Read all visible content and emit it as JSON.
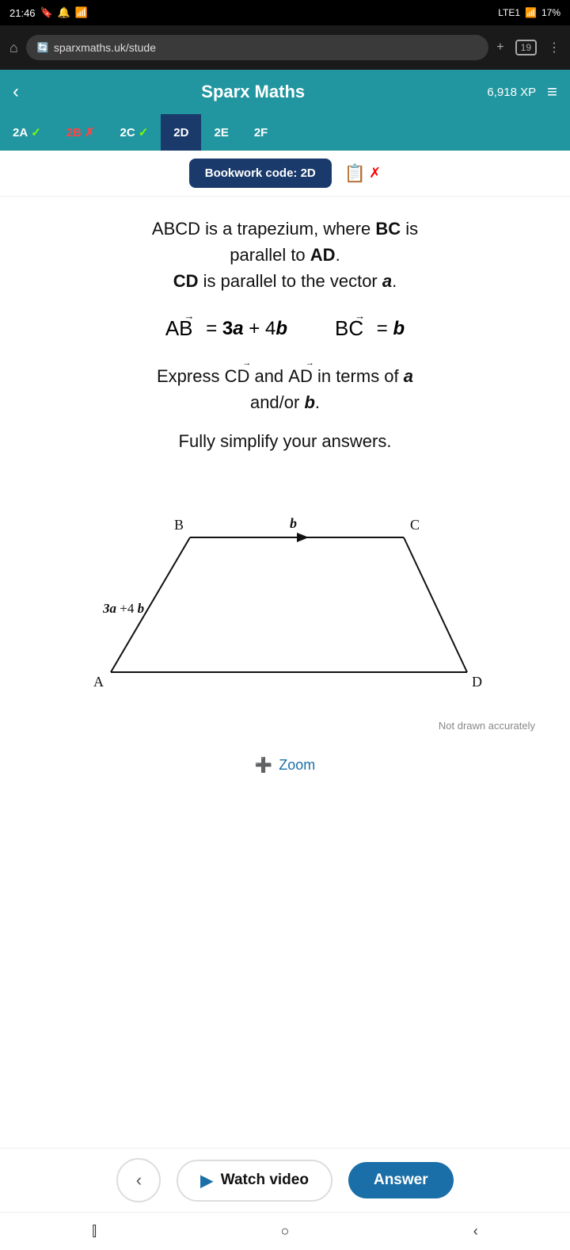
{
  "status_bar": {
    "time": "21:46",
    "battery": "17%"
  },
  "browser": {
    "url": "sparxmaths.uk/stude",
    "tab_count": "19"
  },
  "header": {
    "title": "Sparx Maths",
    "xp": "6,918 XP",
    "back_label": "‹",
    "menu_label": "≡"
  },
  "tabs": [
    {
      "id": "2A",
      "label": "2A",
      "status": "check",
      "active": false
    },
    {
      "id": "2B",
      "label": "2B",
      "status": "cross",
      "active": false
    },
    {
      "id": "2C",
      "label": "2C",
      "status": "check",
      "active": false
    },
    {
      "id": "2D",
      "label": "2D",
      "status": "none",
      "active": true
    },
    {
      "id": "2E",
      "label": "2E",
      "status": "none",
      "active": false
    },
    {
      "id": "2F",
      "label": "2F",
      "status": "none",
      "active": false
    }
  ],
  "bookwork": {
    "label": "Bookwork code: 2D"
  },
  "question": {
    "line1": "ABCD is a trapezium, where BC is",
    "line2": "parallel to AD.",
    "line3": "CD is parallel to the vector a.",
    "vector_ab": "AB",
    "vector_ab_eq": "= 3a + 4b",
    "vector_bc": "BC",
    "vector_bc_eq": "= b",
    "express_line1": "Express CD and AD in terms of a",
    "express_line2": "and/or b.",
    "simplify": "Fully simplify your answers.",
    "diagram_note": "Not drawn accurately"
  },
  "diagram": {
    "b_label": "b",
    "ab_label": "3a + 4b",
    "vertices": {
      "A": "A",
      "B": "B",
      "C": "C",
      "D": "D"
    }
  },
  "zoom": {
    "label": "Zoom"
  },
  "bottom_bar": {
    "back_icon": "‹",
    "watch_video": "Watch video",
    "answer": "Answer"
  }
}
